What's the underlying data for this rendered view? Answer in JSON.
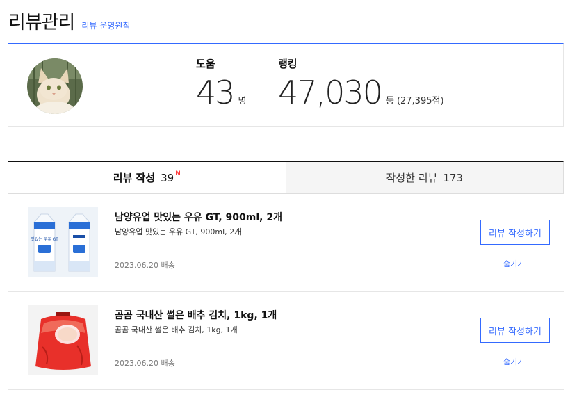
{
  "header": {
    "title": "리뷰관리",
    "policy_link": "리뷰 운영원칙"
  },
  "profile": {
    "avatar_icon": "cat-avatar",
    "help": {
      "label": "도움",
      "value": "43",
      "unit": "명"
    },
    "ranking": {
      "label": "랭킹",
      "value": "47,030",
      "unit": "등",
      "points": "(27,395점)"
    }
  },
  "tabs": [
    {
      "label": "리뷰 작성",
      "count": "39",
      "badge": "N"
    },
    {
      "label": "작성한 리뷰",
      "count": "173"
    }
  ],
  "items": [
    {
      "title": "남양유업 맛있는 우유 GT, 900ml, 2개",
      "subtitle": "남양유업 맛있는 우유 GT, 900ml, 2개",
      "date": "2023.06.20 배송",
      "write_label": "리뷰 작성하기",
      "hide_label": "숨기기",
      "thumb_icon": "milk-carton-image",
      "carton_text": "맛있는 우유 GT"
    },
    {
      "title": "곰곰 국내산 썰은 배추 김치, 1kg, 1개",
      "subtitle": "곰곰 국내산 썰은 배추 김치, 1kg, 1개",
      "date": "2023.06.20 배송",
      "write_label": "리뷰 작성하기",
      "hide_label": "숨기기",
      "thumb_icon": "kimchi-bag-image"
    }
  ],
  "colors": {
    "accent": "#346aff",
    "badge": "#ff2e2e"
  }
}
